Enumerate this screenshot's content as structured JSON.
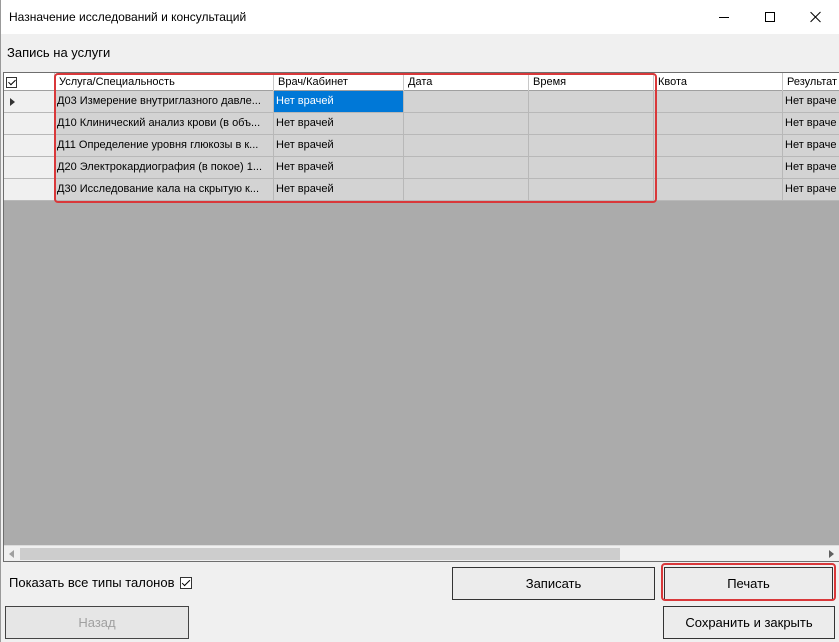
{
  "window": {
    "title": "Назначение исследований и консультаций"
  },
  "section_label": "Запись на услуги",
  "table": {
    "columns": [
      "Услуга/Специальность",
      "Врач/Кабинет",
      "Дата",
      "Время",
      "Квота",
      "Результат"
    ],
    "rows": [
      {
        "service": "Д03 Измерение внутриглазного давле...",
        "doctor": "Нет врачей",
        "date": "",
        "time": "",
        "quota": "",
        "result": "Нет враче"
      },
      {
        "service": "Д10 Клинический анализ крови (в объ...",
        "doctor": "Нет врачей",
        "date": "",
        "time": "",
        "quota": "",
        "result": "Нет враче"
      },
      {
        "service": "Д11 Определение уровня глюкозы в к...",
        "doctor": "Нет врачей",
        "date": "",
        "time": "",
        "quota": "",
        "result": "Нет враче"
      },
      {
        "service": "Д20 Электрокардиография (в покое) 1...",
        "doctor": "Нет врачей",
        "date": "",
        "time": "",
        "quota": "",
        "result": "Нет враче"
      },
      {
        "service": "Д30 Исследование кала на скрытую к...",
        "doctor": "Нет врачей",
        "date": "",
        "time": "",
        "quota": "",
        "result": "Нет враче"
      }
    ]
  },
  "footer": {
    "show_all_label": "Показать все типы талонов",
    "save_label": "Записать",
    "print_label": "Печать",
    "back_label": "Назад",
    "save_close_label": "Сохранить и закрыть"
  }
}
